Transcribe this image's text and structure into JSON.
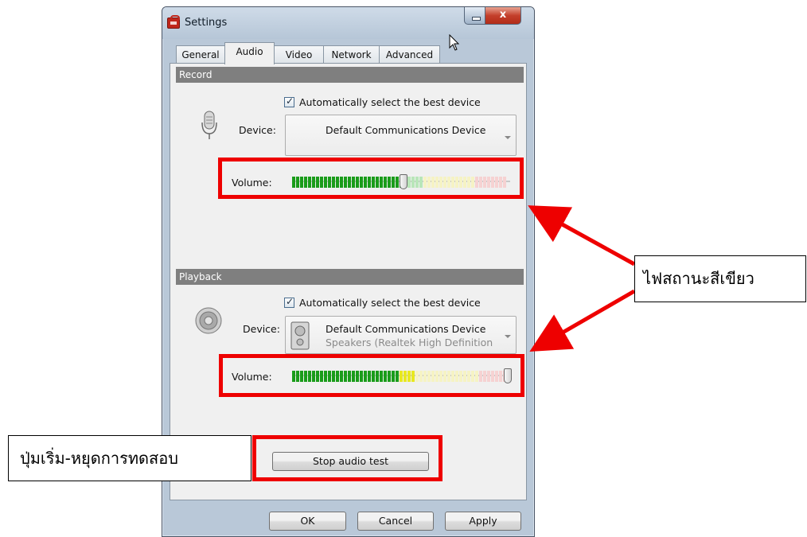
{
  "window": {
    "title": "Settings",
    "close_symbol": "x"
  },
  "tabs": [
    "General",
    "Audio",
    "Video",
    "Network",
    "Advanced"
  ],
  "active_tab": "Audio",
  "record": {
    "header": "Record",
    "auto_label": "Automatically select the best device",
    "device_label": "Device:",
    "device_name": "Default Communications Device",
    "volume_label": "Volume:",
    "volume_level": 0.51
  },
  "playback": {
    "header": "Playback",
    "auto_label": "Automatically select the best device",
    "device_label": "Device:",
    "device_name": "Default Communications Device",
    "device_sub": "Speakers (Realtek High Definition",
    "volume_label": "Volume:",
    "volume_level": 1.0
  },
  "buttons": {
    "stop_test": "Stop audio test",
    "ok": "OK",
    "cancel": "Cancel",
    "apply": "Apply"
  },
  "annotations": {
    "status_light": "ไฟสถานะสีเขียว",
    "start_stop": "ปุ่มเริ่ม-หยุดการทดสอบ",
    "highlight_color": "#ee0000"
  }
}
